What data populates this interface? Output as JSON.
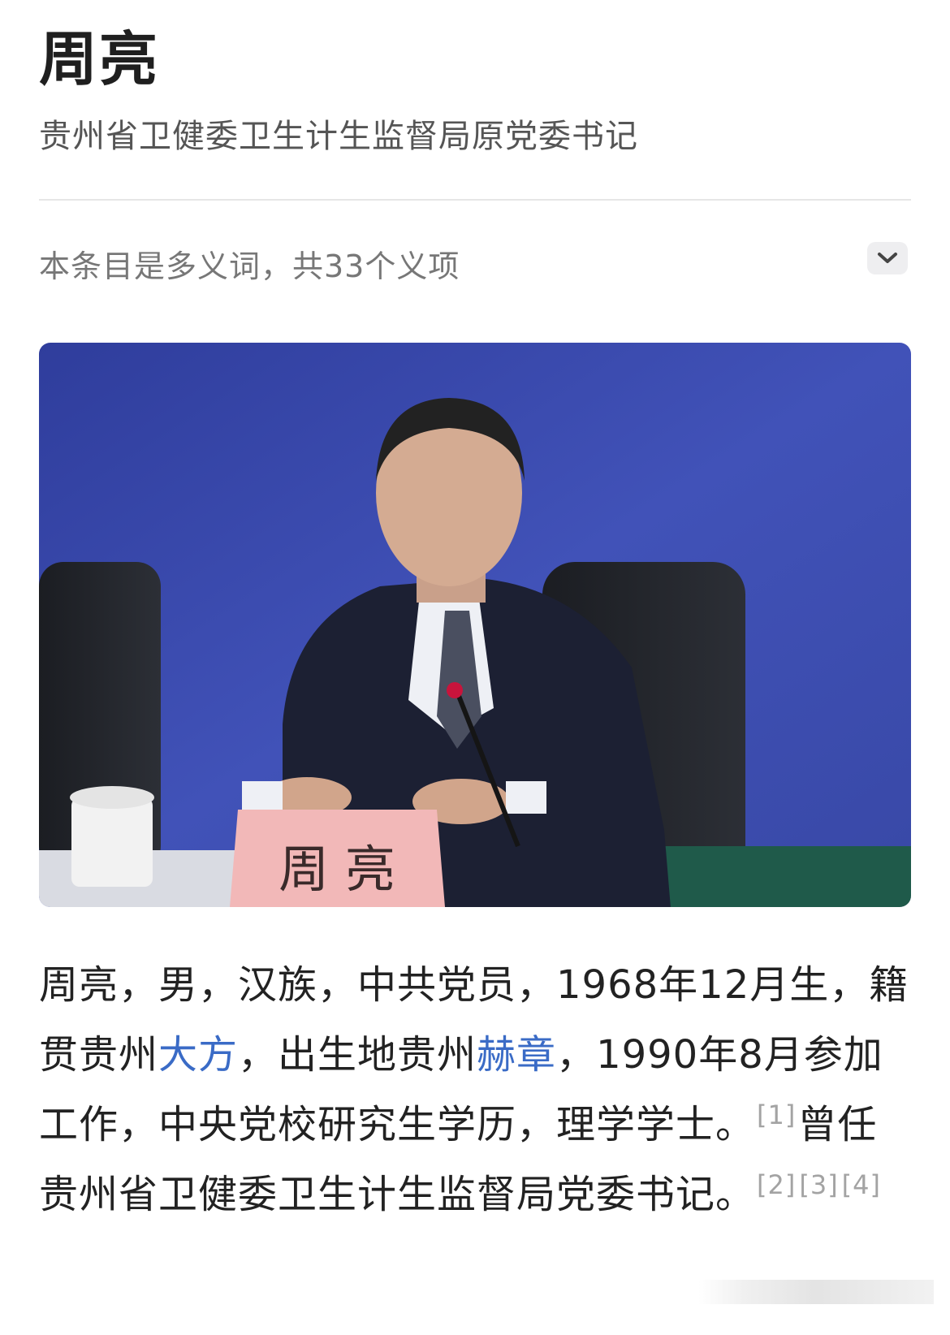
{
  "header": {
    "title": "周亮",
    "subtitle": "贵州省卫健委卫生计生监督局原党委书记"
  },
  "polysemy": {
    "text": "本条目是多义词，共33个义项",
    "expand_icon": "chevron-down-icon"
  },
  "photo": {
    "nameplate": "周 亮",
    "colors": {
      "background": "#3b4aa8",
      "suit": "#1c2033",
      "nameplate": "#f2b8b8"
    }
  },
  "summary": {
    "part1": "周亮，男，汉族，中共党员，1968年12月生，籍贯贵州",
    "link1": "大方",
    "part2": "，出生地贵州",
    "link2": "赫章",
    "part3": "，1990年8月参加工作，中央党校研究生学历，理学学士。",
    "ref1": "[1]",
    "part4": "曾任贵州省卫健委卫生计生监督局党委书记。",
    "ref2": "[2]",
    "ref3": "[3]",
    "ref4": "[4]"
  },
  "colors": {
    "link": "#3a6bc6",
    "ref": "#a3a3a3",
    "text": "#222222"
  }
}
